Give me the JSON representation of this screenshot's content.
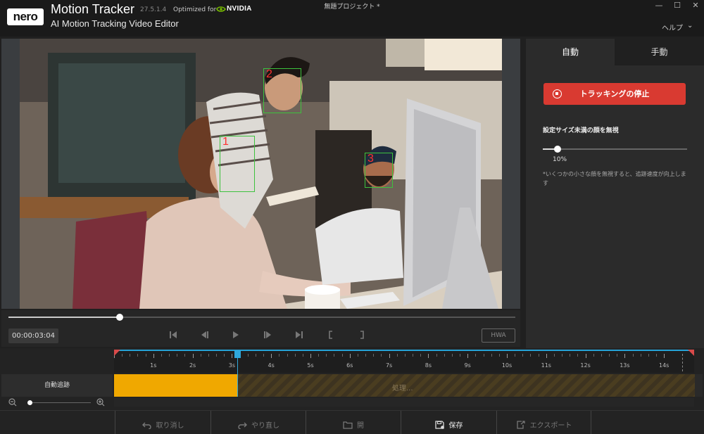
{
  "header": {
    "logo": "nero",
    "app_name": "Motion Tracker",
    "version": "27.5.1.4",
    "optimized_for": "Optimized for",
    "nvidia": "NVIDIA",
    "subtitle": "AI Motion Tracking Video Editor",
    "document_title": "無題プロジェクト *",
    "help_menu": "ヘルプ"
  },
  "video": {
    "faces": [
      {
        "label": "1"
      },
      {
        "label": "2"
      },
      {
        "label": "3"
      }
    ],
    "progress_fraction": 0.22
  },
  "transport": {
    "timecode": "00:00:03:04",
    "hwa_label": "HWA"
  },
  "right_panel": {
    "tabs": [
      {
        "label": "自動",
        "selected": true
      },
      {
        "label": "手動",
        "selected": false
      }
    ],
    "stop_button": "トラッキングの停止",
    "ignore_label": "設定サイズ未満の顔を無視",
    "size_value": "10%",
    "size_fraction": 0.1,
    "note": "*いくつかの小さな顔を無視すると、追跡速度が向上します"
  },
  "timeline": {
    "track_label": "自動追跡",
    "processing_text": "処理...",
    "ticks": [
      "1s",
      "2s",
      "3s",
      "4s",
      "5s",
      "6s",
      "7s",
      "8s",
      "9s",
      "10s",
      "11s",
      "12s",
      "13s",
      "14s"
    ],
    "playhead_seconds": 3.1,
    "zoom_fraction": 0.03
  },
  "toolbar": {
    "undo": "取り消し",
    "redo": "やり直し",
    "open": "開",
    "save": "保存",
    "export": "エクスポート"
  },
  "colors": {
    "accent_red": "#d93a31",
    "playhead_blue": "#2fa8dc",
    "tracked_orange": "#f0a800",
    "face_box_green": "#3dc23d"
  }
}
